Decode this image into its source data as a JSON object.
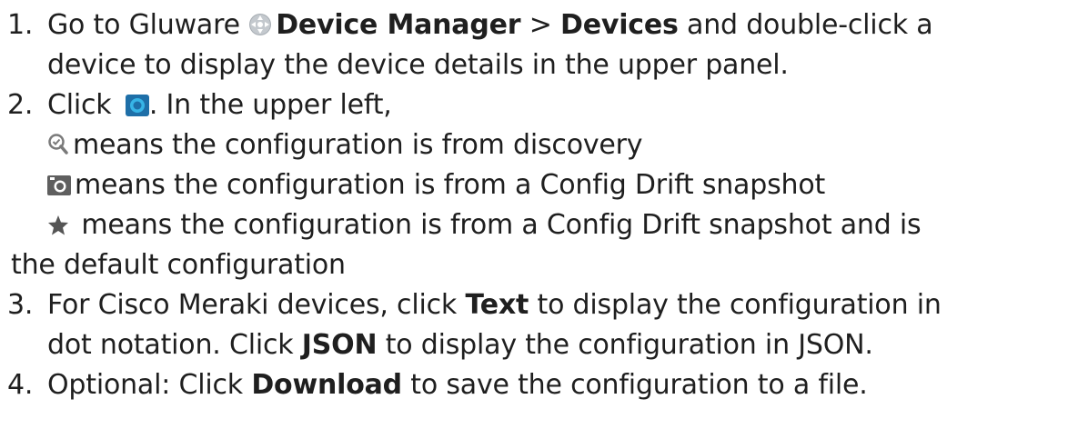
{
  "steps": [
    {
      "number": "1.",
      "line1_a": "Go to Gluware",
      "line1_b": "Device Manager",
      "line1_c": ">",
      "line1_d": "Devices",
      "line1_e": "and double-click a",
      "line2": "device to display the device details in the upper panel.",
      "icon": "gluware-app-icon"
    },
    {
      "number": "2.",
      "line1_a": "Click",
      "line1_b": ". In the upper left,",
      "icon": "config-view-icon",
      "legend": [
        {
          "icon": "discovery-icon",
          "text": "means the configuration is from discovery"
        },
        {
          "icon": "camera-icon",
          "text": "means the configuration is from a Config Drift snapshot"
        },
        {
          "icon": "star-icon",
          "text": "means the configuration is from a Config Drift snapshot and is",
          "continuation": "the default configuration"
        }
      ]
    },
    {
      "number": "3.",
      "line1_a": "For Cisco Meraki devices, click",
      "line1_b": "Text",
      "line1_c": "to display the configuration in",
      "line2_a": "dot notation. Click",
      "line2_b": "JSON",
      "line2_c": "to display the configuration in JSON."
    },
    {
      "number": "4.",
      "line1_a": "Optional: Click",
      "line1_b": "Download",
      "line1_c": "to save the configuration to a file."
    }
  ],
  "colors": {
    "text": "#1f1f1f",
    "gluware_icon": "#9aa0a6",
    "config_view_icon_bg": "#1e6fa8",
    "config_view_icon_ring": "#37b4e6",
    "legend_icon": "#6b6b6b"
  }
}
